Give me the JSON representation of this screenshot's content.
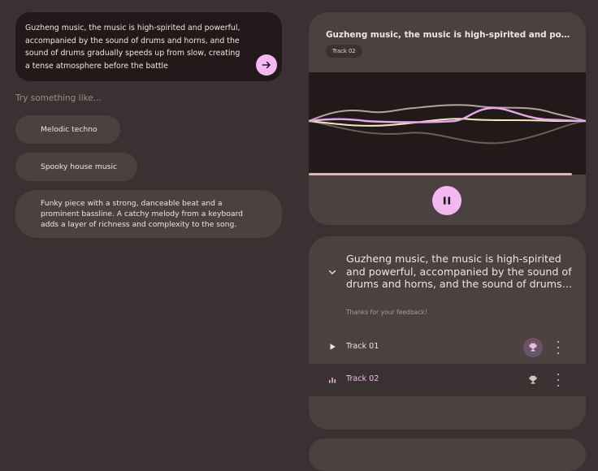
{
  "prompt_input": {
    "text": "Guzheng music, the music is high-spirited and powerful, accompanied by the sound of drums and horns, and the sound of drums gradually speeds up from slow, creating a tense atmosphere before the battle",
    "send_icon": "arrow-right-icon"
  },
  "suggestions": {
    "label": "Try something like...",
    "items": [
      "Melodic techno",
      "Spooky house music",
      "Funky piece with a strong, danceable beat and a prominent bassline. A catchy melody from a keyboard adds a layer of richness and complexity to the song."
    ]
  },
  "player": {
    "title": "Guzheng music, the music is high-spirited and powerful, accompanied by the sound of drums and horns, and the sound of drums gradually speeds up from slow, creating a tense atmosphere before the battle",
    "track_badge": "Track 02",
    "pause_icon": "pause-icon"
  },
  "results": {
    "prompt": "Guzheng music, the music is high-spirited and powerful, accompanied by the sound of drums and horns, and the sound of drums…",
    "feedback": "Thanks for your feedback!",
    "tracks": [
      {
        "name": "Track 01",
        "state": "idle",
        "icon": "play-icon"
      },
      {
        "name": "Track 02",
        "state": "playing",
        "icon": "equalizer-icon"
      }
    ]
  },
  "colors": {
    "background": "#3a3232",
    "card": "#4a4140",
    "dark": "#221a1a",
    "accent": "#f3b8ef"
  }
}
